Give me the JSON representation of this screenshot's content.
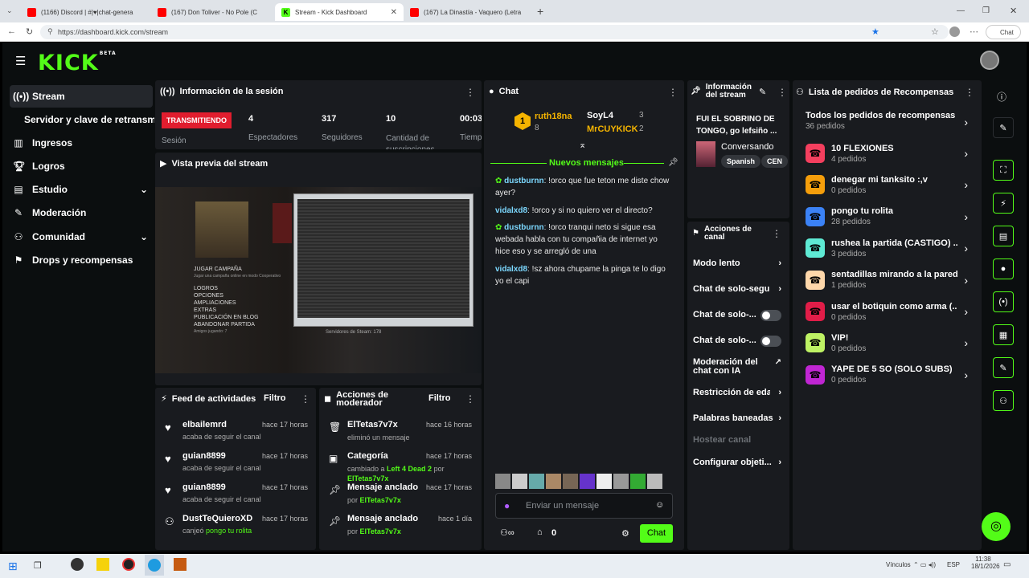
{
  "browser": {
    "tabs": [
      {
        "label": "(1166) Discord | #|♥|chat-genera",
        "color": "#5865f2"
      },
      {
        "label": "(167) Don Toliver - No Pole (C",
        "color": "#ff0000"
      },
      {
        "label": "Stream - Kick Dashboard",
        "color": "#53fc18"
      },
      {
        "label": "(167) La Dinastía - Vaquero (Letra",
        "color": "#ff0000"
      }
    ],
    "url": "https://dashboard.kick.com/stream",
    "chat_button": "Chat"
  },
  "logo": {
    "text": "KICK",
    "badge": "BETA"
  },
  "sidebar": {
    "items": [
      {
        "label": "Stream",
        "icon": "broadcast-icon"
      },
      {
        "label": "Servidor y clave de retransm"
      },
      {
        "label": "Ingresos",
        "icon": "chart-icon"
      },
      {
        "label": "Logros",
        "icon": "trophy-icon"
      },
      {
        "label": "Estudio",
        "icon": "studio-icon"
      },
      {
        "label": "Moderación",
        "icon": "wrench-icon"
      },
      {
        "label": "Comunidad",
        "icon": "community-icon"
      },
      {
        "label": "Drops y recompensas",
        "icon": "gift-icon"
      }
    ]
  },
  "session": {
    "title": "Información de la sesión",
    "status": "TRANSMITIENDO",
    "status_label": "Sesión",
    "stats": [
      {
        "value": "4",
        "label": "Espectadores"
      },
      {
        "value": "317",
        "label": "Seguidores"
      },
      {
        "value": "10",
        "label": "Cantidad de suscripciones"
      },
      {
        "value": "00:03",
        "label": "Tiempo en vivo"
      }
    ]
  },
  "preview": {
    "title": "Vista previa del stream",
    "menu": [
      "JUGAR CAMPAÑA",
      "Jugar una campaña online en modo Cooperativo",
      "LOGROS",
      "OPCIONES",
      "AMPLIACIONES",
      "EXTRAS",
      "PUBLICACIÓN EN BLOG",
      "ABANDONAR PARTIDA",
      "Amigos jugando: 7",
      "Servidores de Steam: 178"
    ]
  },
  "activity": {
    "title": "Feed de actividades",
    "filter": "Filtro",
    "items": [
      {
        "user": "elbailemrd",
        "time": "hace 17 horas",
        "text": "acaba de seguir el canal"
      },
      {
        "user": "guian8899",
        "time": "hace 17 horas",
        "text": "acaba de seguir el canal"
      },
      {
        "user": "guian8899",
        "time": "hace 17 horas",
        "text": "acaba de seguir el canal"
      },
      {
        "user": "DustTeQuieroXD",
        "time": "hace 17 horas",
        "text": "canjeó",
        "highlight": "pongo tu rolita"
      }
    ]
  },
  "modactions": {
    "title": "Acciones de moderador",
    "filter": "Filtro",
    "items": [
      {
        "user": "ElTetas7v7x",
        "time": "hace 16 horas",
        "pre": "eliminó un mensaje",
        "mid": "",
        "post": "",
        "by": ""
      },
      {
        "user": "Categoría",
        "time": "hace 17 horas",
        "pre": "cambiado a",
        "mid": "Left 4 Dead 2",
        "post": "por",
        "by": "ElTetas7v7x"
      },
      {
        "user": "Mensaje anclado",
        "time": "hace 17 horas",
        "pre": "por",
        "mid": "",
        "post": "",
        "by": "ElTetas7v7x"
      },
      {
        "user": "Mensaje anclado",
        "time": "hace 1 día",
        "pre": "por",
        "mid": "",
        "post": "",
        "by": "ElTetas7v7x"
      }
    ]
  },
  "chat": {
    "title": "Chat",
    "leaderboard": [
      {
        "rank": "1",
        "name": "ruth18na",
        "count": "8"
      },
      {
        "name": "SoyL4",
        "count": "3"
      },
      {
        "name": "MrCUYKICK",
        "count": "2"
      }
    ],
    "new_messages": "Nuevos mensajes",
    "messages": [
      {
        "user": "dustburnn",
        "text": "!orco que fue teton me diste chow ayer?"
      },
      {
        "user": "vidalxd8",
        "text": "!orco y si no quiero ver el directo?"
      },
      {
        "user": "dustburnn",
        "text": "!orco tranqui neto si sigue esa webada habla con tu compañia de internet yo hice eso y se arregló de una"
      },
      {
        "user": "vidalxd8",
        "text": "!sz ahora chupame la pinga te lo digo yo el capi"
      }
    ],
    "placeholder": "Enviar un mensaje",
    "points": "0",
    "send": "Chat"
  },
  "stream_info": {
    "title": "Información del stream",
    "stream_title": "FUI EL SOBRINO DE TONGO, go lefsiño ...",
    "category": "Conversando",
    "tags": [
      "Spanish",
      "CEN"
    ]
  },
  "channel_actions": {
    "title": "Acciones de canal",
    "items": [
      "Modo lento",
      "Chat de solo-seguid",
      "Chat de solo-...",
      "Chat de solo-...",
      "Moderación del chat con IA",
      "Restricción de edad",
      "Palabras baneadas",
      "Hostear canal",
      "Configurar objeti..."
    ]
  },
  "rewards": {
    "title": "Lista de pedidos de Recompensas",
    "all_title": "Todos los pedidos de recompensas",
    "all_count": "36 pedidos",
    "items": [
      {
        "name": "10 FLEXIONES",
        "count": "4 pedidos",
        "color": "#f43f5e"
      },
      {
        "name": "denegar mi tanksito :,v",
        "count": "0 pedidos",
        "color": "#f59e0b"
      },
      {
        "name": "pongo tu rolita",
        "count": "28 pedidos",
        "color": "#3b82f6"
      },
      {
        "name": "rushea la partida (CASTIGO) ...",
        "count": "3 pedidos",
        "color": "#5eead4"
      },
      {
        "name": "sentadillas mirando a la pared",
        "count": "1 pedidos",
        "color": "#fed7aa"
      },
      {
        "name": "usar el botiquin como arma (...",
        "count": "0 pedidos",
        "color": "#e11d48"
      },
      {
        "name": "VIP!",
        "count": "0 pedidos",
        "color": "#bef264"
      },
      {
        "name": "YAPE DE 5 SO (SOLO SUBS)",
        "count": "0 pedidos",
        "color": "#c026d3"
      }
    ]
  },
  "taskbar": {
    "links": "Vínculos",
    "lang": "ESP",
    "time": "11:38",
    "date": "18/1/2026"
  },
  "colors": {
    "accent": "#53fc18",
    "panel": "#191b1f",
    "bg": "#0b0e0f"
  }
}
